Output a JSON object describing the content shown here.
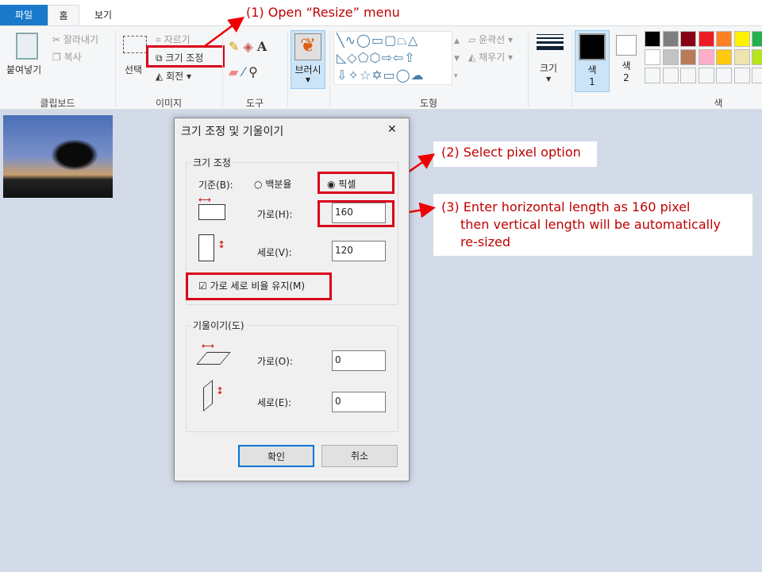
{
  "tabs": [
    {
      "label": "파일"
    },
    {
      "label": "홈"
    },
    {
      "label": "보기"
    }
  ],
  "ribbon": {
    "clipboard": {
      "paste": "붙여넣기",
      "cut": "잘라내기",
      "copy": "복사",
      "label": "클립보드"
    },
    "image": {
      "select": "선택",
      "crop": "자르기",
      "resize": "크기 조정",
      "rotate": "회전",
      "label": "이미지"
    },
    "tools": {
      "label": "도구"
    },
    "brush": {
      "label": "브러시"
    },
    "shapes": {
      "outline": "윤곽선",
      "fill": "채우기",
      "label": "도형"
    },
    "size": {
      "label": "크기"
    },
    "colors": {
      "color1": "색",
      "color1_num": "1",
      "color2": "색",
      "color2_num": "2",
      "label": "색",
      "palette": [
        "#000000",
        "#7f7f7f",
        "#880015",
        "#ed1c24",
        "#ff7f27",
        "#fff200",
        "#22b14c",
        "#ffffff",
        "#c3c3c3",
        "#b97a57",
        "#ffaec9",
        "#ffc90e",
        "#efe4b0",
        "#b5e61d"
      ]
    }
  },
  "annotations": {
    "a1": "(1) Open “Resize” menu",
    "a2": "(2) Select pixel option",
    "a3_1": "(3) Enter horizontal length as 160 pixel",
    "a3_2": "then vertical length will be automatically",
    "a3_3": "re-sized",
    "color": "#c00000"
  },
  "dialog": {
    "title": "크기 조정 및 기울이기",
    "close": "✕",
    "resize": {
      "legend": "크기 조정",
      "basis": "기준(B):",
      "percent": "백분율",
      "pixel": "픽셀",
      "selected": "pixel",
      "horizontal_label": "가로(H):",
      "horizontal": "160",
      "vertical_label": "세로(V):",
      "vertical": "120",
      "keep_ratio": "가로 세로 비율 유지(M)",
      "keep_ratio_checked": true
    },
    "skew": {
      "legend": "기울이기(도)",
      "horizontal_label": "가로(O):",
      "horizontal": "0",
      "vertical_label": "세로(E):",
      "vertical": "0"
    },
    "ok": "확인",
    "cancel": "취소"
  }
}
